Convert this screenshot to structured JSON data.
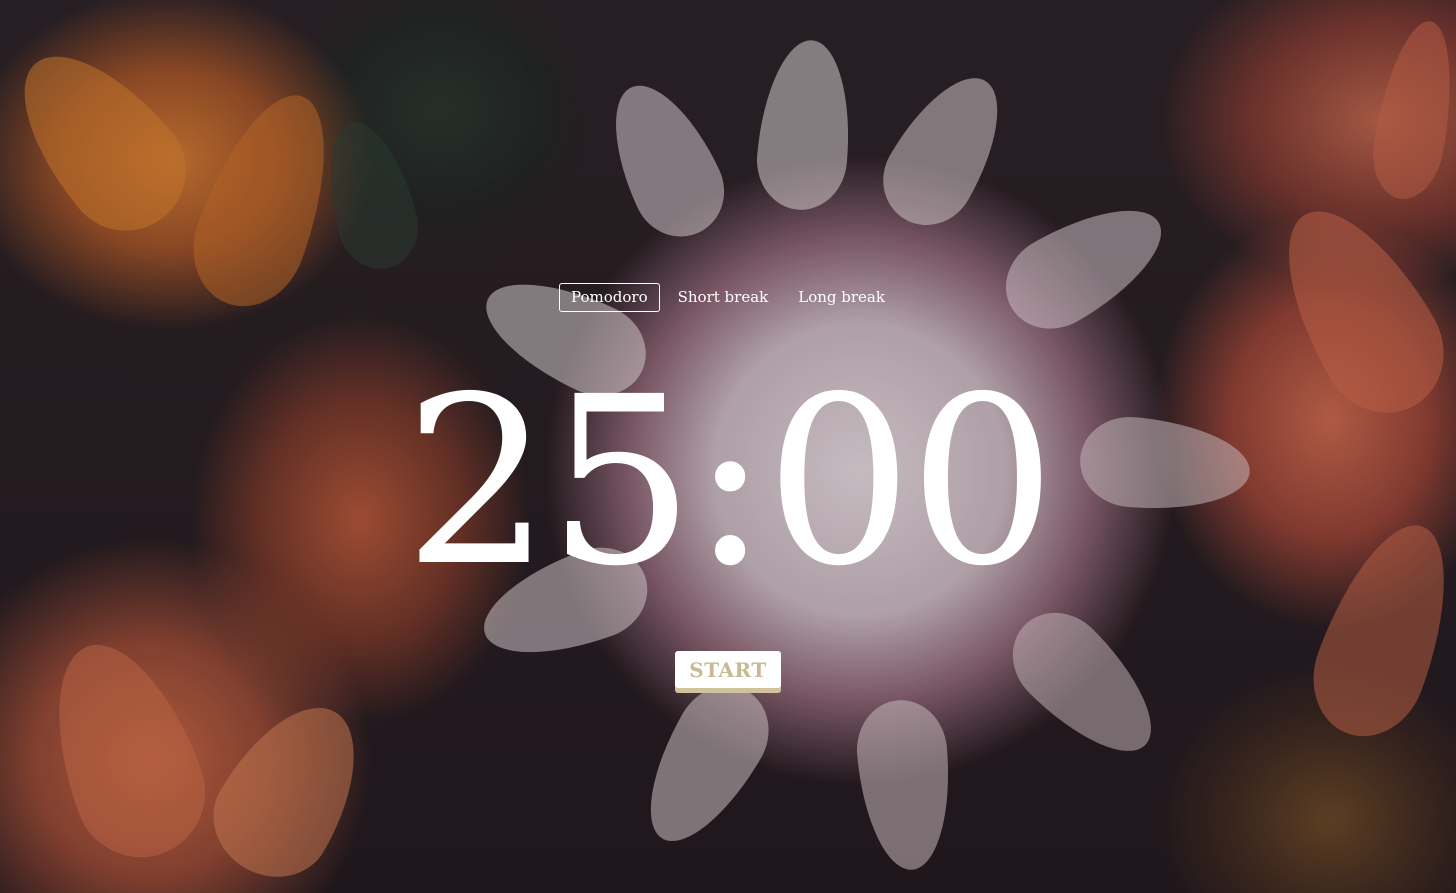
{
  "tabs": [
    {
      "label": "Pomodoro",
      "active": true
    },
    {
      "label": "Short break",
      "active": false
    },
    {
      "label": "Long break",
      "active": false
    }
  ],
  "timer": {
    "display": "25:00"
  },
  "controls": {
    "start_label": "START"
  },
  "colors": {
    "text": "#ffffff",
    "start_text": "#c7b994",
    "start_bg": "#ffffff",
    "start_shadow": "#cfc29d"
  }
}
